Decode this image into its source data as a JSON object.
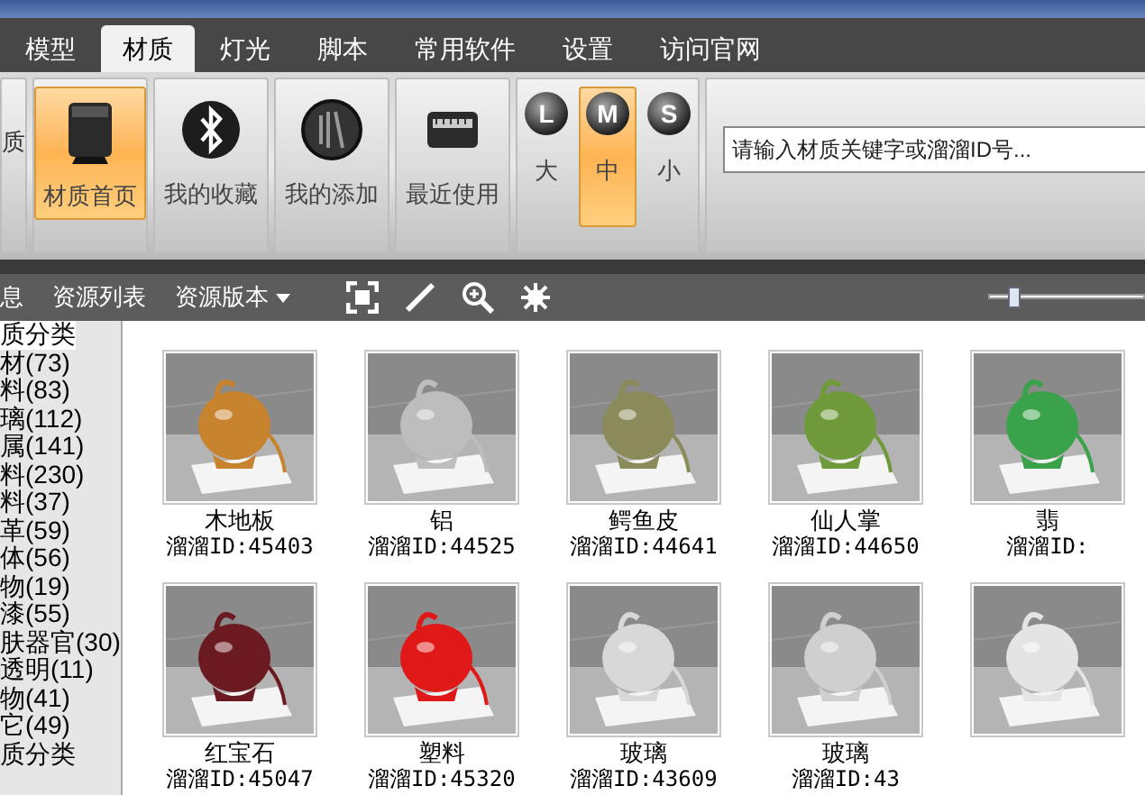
{
  "tabs": [
    {
      "label": "模型",
      "selected": false
    },
    {
      "label": "材质",
      "selected": true
    },
    {
      "label": "灯光",
      "selected": false
    },
    {
      "label": "脚本",
      "selected": false
    },
    {
      "label": "常用软件",
      "selected": false
    },
    {
      "label": "设置",
      "selected": false
    },
    {
      "label": "访问官网",
      "selected": false
    }
  ],
  "ribbon": {
    "partial_label": "质",
    "buttons": [
      {
        "label": "材质首页",
        "selected": true
      },
      {
        "label": "我的收藏",
        "selected": false
      },
      {
        "label": "我的添加",
        "selected": false
      },
      {
        "label": "最近使用",
        "selected": false
      }
    ],
    "sizes": [
      {
        "letter": "L",
        "label": "大",
        "selected": false
      },
      {
        "letter": "M",
        "label": "中",
        "selected": true
      },
      {
        "letter": "S",
        "label": "小",
        "selected": false
      }
    ],
    "search": {
      "placeholder": "请输入材质关键字或溜溜ID号..."
    }
  },
  "toolbar": {
    "items": [
      {
        "label": "息",
        "dropdown": false
      },
      {
        "label": "资源列表",
        "dropdown": false
      },
      {
        "label": "资源版本",
        "dropdown": true
      }
    ],
    "slider": {
      "level": 0.15
    }
  },
  "categories": [
    {
      "label": "质分类",
      "selected": true
    },
    {
      "label": "材(73)",
      "selected": false
    },
    {
      "label": "料(83)",
      "selected": false
    },
    {
      "label": "璃(112)",
      "selected": false
    },
    {
      "label": "属(141)",
      "selected": false
    },
    {
      "label": "料(230)",
      "selected": false
    },
    {
      "label": "料(37)",
      "selected": false
    },
    {
      "label": "革(59)",
      "selected": false
    },
    {
      "label": "体(56)",
      "selected": false
    },
    {
      "label": "物(19)",
      "selected": false
    },
    {
      "label": "漆(55)",
      "selected": false
    },
    {
      "label": "肤器官(30)",
      "selected": false
    },
    {
      "label": "透明(11)",
      "selected": false
    },
    {
      "label": "物(41)",
      "selected": false
    },
    {
      "label": "它(49)",
      "selected": false
    },
    {
      "label": "质分类",
      "selected": false
    }
  ],
  "materials": [
    {
      "name": "木地板",
      "id": "溜溜ID:45403"
    },
    {
      "name": "铝",
      "id": "溜溜ID:44525"
    },
    {
      "name": "鳄鱼皮",
      "id": "溜溜ID:44641"
    },
    {
      "name": "仙人掌",
      "id": "溜溜ID:44650"
    },
    {
      "name": "翡",
      "id": "溜溜ID:"
    },
    {
      "name": "红宝石",
      "id": "溜溜ID:45047"
    },
    {
      "name": "塑料",
      "id": "溜溜ID:45320"
    },
    {
      "name": "玻璃",
      "id": "溜溜ID:43609"
    },
    {
      "name": "玻璃",
      "id": "溜溜ID:43"
    },
    {
      "kind": "picture"
    }
  ]
}
